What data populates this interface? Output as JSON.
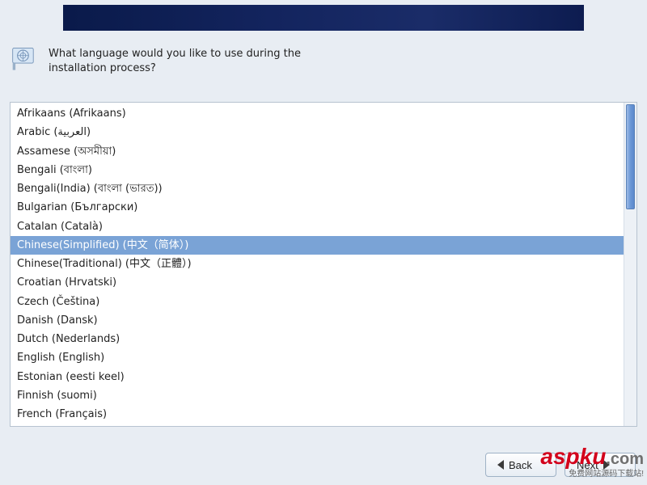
{
  "prompt": "What language would you like to use during the installation process?",
  "icon": "un-flag-icon",
  "languages": [
    {
      "label": "Afrikaans (Afrikaans)",
      "selected": false
    },
    {
      "label": "Arabic (العربية)",
      "selected": false
    },
    {
      "label": "Assamese (অসমীয়া)",
      "selected": false
    },
    {
      "label": "Bengali (বাংলা)",
      "selected": false
    },
    {
      "label": "Bengali(India) (বাংলা (ভারত))",
      "selected": false
    },
    {
      "label": "Bulgarian (Български)",
      "selected": false
    },
    {
      "label": "Catalan (Català)",
      "selected": false
    },
    {
      "label": "Chinese(Simplified) (中文（简体）)",
      "selected": true
    },
    {
      "label": "Chinese(Traditional) (中文（正體）)",
      "selected": false
    },
    {
      "label": "Croatian (Hrvatski)",
      "selected": false
    },
    {
      "label": "Czech (Čeština)",
      "selected": false
    },
    {
      "label": "Danish (Dansk)",
      "selected": false
    },
    {
      "label": "Dutch (Nederlands)",
      "selected": false
    },
    {
      "label": "English (English)",
      "selected": false
    },
    {
      "label": "Estonian (eesti keel)",
      "selected": false
    },
    {
      "label": "Finnish (suomi)",
      "selected": false
    },
    {
      "label": "French (Français)",
      "selected": false
    }
  ],
  "buttons": {
    "back": "Back",
    "next": "Next"
  },
  "watermark": {
    "brand_red": "aspku",
    "brand_grey": ".com",
    "strap": "免费网站源码下载站!"
  }
}
